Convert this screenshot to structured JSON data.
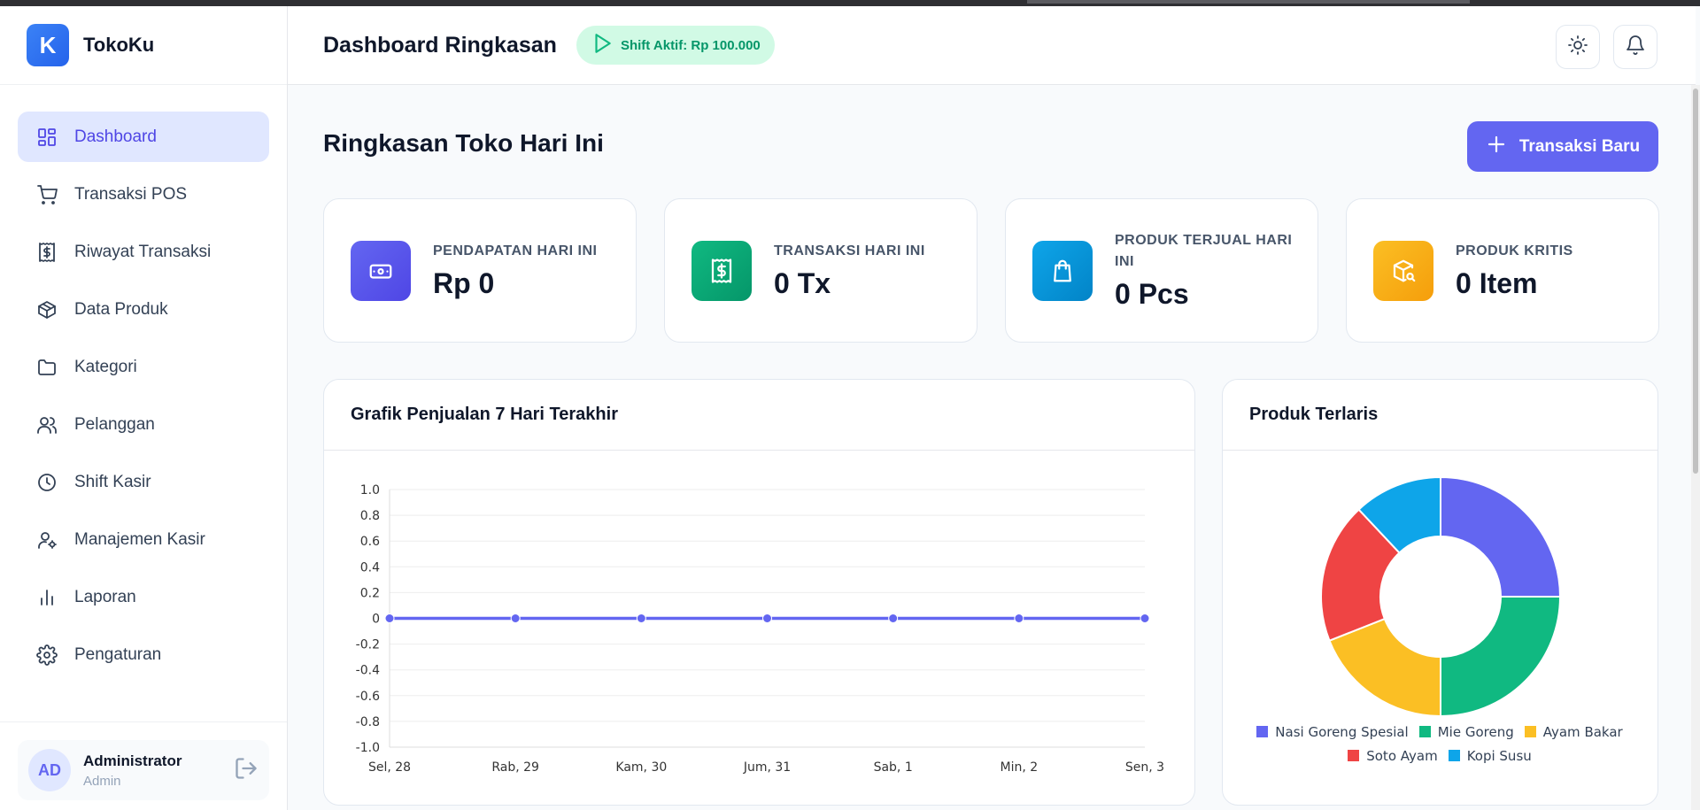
{
  "brand": {
    "logo_letter": "K",
    "name": "TokoKu"
  },
  "sidebar": {
    "items": [
      {
        "label": "Dashboard",
        "icon": "dashboard-icon",
        "active": true
      },
      {
        "label": "Transaksi POS",
        "icon": "cart-icon"
      },
      {
        "label": "Riwayat Transaksi",
        "icon": "receipt-icon"
      },
      {
        "label": "Data Produk",
        "icon": "box-icon"
      },
      {
        "label": "Kategori",
        "icon": "folder-icon"
      },
      {
        "label": "Pelanggan",
        "icon": "users-icon"
      },
      {
        "label": "Shift Kasir",
        "icon": "clock-icon"
      },
      {
        "label": "Manajemen Kasir",
        "icon": "user-cog-icon"
      },
      {
        "label": "Laporan",
        "icon": "bar-chart-icon"
      },
      {
        "label": "Pengaturan",
        "icon": "gear-icon"
      }
    ]
  },
  "user": {
    "initials": "AD",
    "name": "Administrator",
    "role": "Admin"
  },
  "header": {
    "title": "Dashboard Ringkasan",
    "shift_badge": "Shift Aktif: Rp 100.000"
  },
  "main": {
    "section_title": "Ringkasan Toko Hari Ini",
    "new_transaction_label": "Transaksi Baru",
    "stats": [
      {
        "label": "PENDAPATAN HARI INI",
        "value": "Rp 0",
        "color": "#6366f1",
        "icon": "money-icon"
      },
      {
        "label": "TRANSAKSI HARI INI",
        "value": "0 Tx",
        "color": "#10b981",
        "icon": "receipt-icon"
      },
      {
        "label": "PRODUK TERJUAL HARI INI",
        "value": "0 Pcs",
        "color": "#0ea5e9",
        "icon": "shopping-bag-icon"
      },
      {
        "label": "PRODUK KRITIS",
        "value": "0 Item",
        "color": "#f59e0b",
        "icon": "package-search-icon"
      }
    ],
    "sales_panel_title": "Grafik Penjualan 7 Hari Terakhir",
    "top_products_title": "Produk Terlaris"
  },
  "chart_data": [
    {
      "type": "line",
      "title": "Grafik Penjualan 7 Hari Terakhir",
      "categories": [
        "Sel, 28",
        "Rab, 29",
        "Kam, 30",
        "Jum, 31",
        "Sab, 1",
        "Min, 2",
        "Sen, 3"
      ],
      "series": [
        {
          "values": [
            0,
            0,
            0,
            0,
            0,
            0,
            0
          ],
          "color": "#6366f1"
        }
      ],
      "yticks": [
        "1.0",
        "0.8",
        "0.6",
        "0.4",
        "0.2",
        "0",
        "-0.2",
        "-0.4",
        "-0.6",
        "-0.8",
        "-1.0"
      ],
      "ylim": [
        -1,
        1
      ],
      "grid": true
    },
    {
      "type": "pie",
      "title": "Produk Terlaris",
      "labels": [
        "Nasi Goreng Spesial",
        "Mie Goreng",
        "Ayam Bakar",
        "Soto Ayam",
        "Kopi Susu"
      ],
      "values": [
        25,
        25,
        19,
        19,
        12
      ],
      "colors": [
        "#6366f1",
        "#10b981",
        "#fbbf24",
        "#ef4444",
        "#0ea5e9"
      ],
      "legend": "bottom"
    }
  ]
}
